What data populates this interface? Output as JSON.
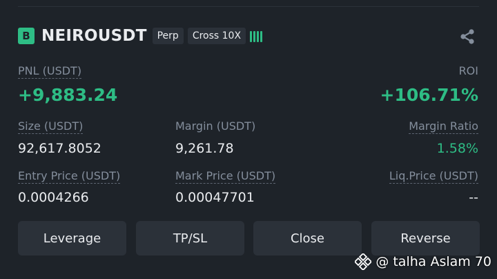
{
  "position": {
    "side_badge": "B",
    "symbol": "NEIROUSDT",
    "tags": [
      "Perp",
      "Cross 10X"
    ],
    "adl_icon": "adl-bars-icon",
    "share_icon": "share-icon"
  },
  "pnl": {
    "label": "PNL (USDT)",
    "value": "+9,883.24"
  },
  "roi": {
    "label": "ROI",
    "value": "+106.71%"
  },
  "size": {
    "label": "Size (USDT)",
    "value": "92,617.8052"
  },
  "margin": {
    "label": "Margin (USDT)",
    "value": "9,261.78"
  },
  "margin_ratio": {
    "label": "Margin Ratio",
    "value": "1.58%"
  },
  "entry_price": {
    "label": "Entry Price (USDT)",
    "value": "0.0004266"
  },
  "mark_price": {
    "label": "Mark Price (USDT)",
    "value": "0.00047701"
  },
  "liq_price": {
    "label": "Liq.Price (USDT)",
    "value": "--"
  },
  "actions": [
    "Leverage",
    "TP/SL",
    "Close",
    "Reverse"
  ],
  "watermark": "@ talha Aslam 70",
  "colors": {
    "background": "#1e2329",
    "positive": "#2ebd85",
    "muted": "#848e9c",
    "button": "#2b3139"
  }
}
